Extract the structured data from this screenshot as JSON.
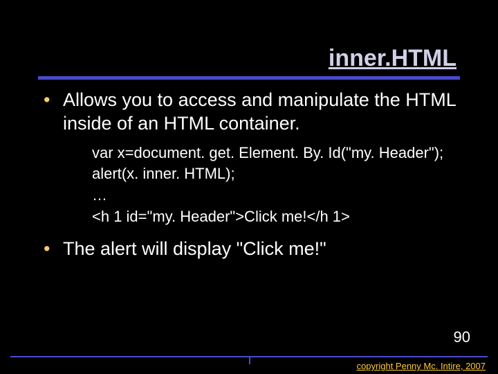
{
  "title": "inner.HTML",
  "bullets": {
    "b1": "Allows you to access and manipulate the HTML inside of an HTML container.",
    "b2": "The alert will display \"Click me!\""
  },
  "code": "var x=document. get. Element. By. Id(\"my. Header\");\nalert(x. inner. HTML);\n…\n<h 1 id=\"my. Header\">Click me!</h 1>",
  "page_number": "90",
  "copyright": "copyright Penny Mc. Intire, 2007"
}
